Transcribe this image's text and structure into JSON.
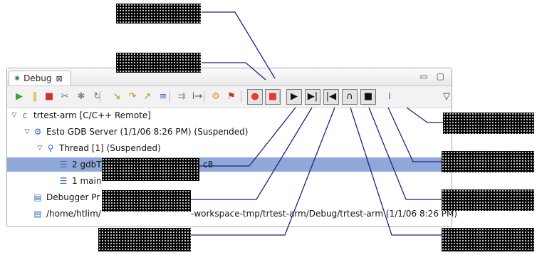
{
  "view": {
    "tab_title": "Debug",
    "tab_close": "⊠",
    "window_controls": "▭ ▢"
  },
  "toolbar_buttons": [
    {
      "name": "resume-icon",
      "glyph": "▶",
      "color": "#3aa03a"
    },
    {
      "name": "suspend-icon",
      "glyph": "‖",
      "color": "#c9a000"
    },
    {
      "name": "terminate-icon",
      "glyph": "■",
      "color": "#d32f2f"
    },
    {
      "name": "disconnect-icon",
      "glyph": "✂",
      "color": "#607d8b"
    },
    {
      "name": "remove-terminated-icon",
      "glyph": "✱",
      "color": "#7f8c8d"
    },
    {
      "name": "relaunch-icon",
      "glyph": "↻",
      "color": "#8e6b2e"
    },
    {
      "name": "step-into-icon",
      "glyph": "↘",
      "color": "#c08a00"
    },
    {
      "name": "step-over-icon",
      "glyph": "↷",
      "color": "#c08a00"
    },
    {
      "name": "step-return-icon",
      "glyph": "↗",
      "color": "#c08a00"
    },
    {
      "name": "drop-to-frame-icon",
      "glyph": "≡",
      "color": "#3b6fb6"
    },
    {
      "name": "instruction-stepping-icon",
      "glyph": "⇉",
      "color": "#888888"
    },
    {
      "name": "step-filters-icon",
      "glyph": "i→",
      "color": "#555555"
    },
    {
      "name": "connect-icon",
      "glyph": "⚙",
      "color": "#d4a017"
    },
    {
      "name": "disconnect-target-icon",
      "glyph": "⚑",
      "color": "#c0392b"
    },
    {
      "name": "record-icon",
      "glyph": "●",
      "color": "#e53935"
    },
    {
      "name": "stop-record-icon",
      "glyph": "■",
      "color": "#e53935"
    },
    {
      "name": "run-icon",
      "glyph": "▶",
      "color": "#111111"
    },
    {
      "name": "step-forward-icon",
      "glyph": "▶|",
      "color": "#111111"
    },
    {
      "name": "step-back-icon",
      "glyph": "|◀",
      "color": "#111111"
    },
    {
      "name": "reverse-icon",
      "glyph": "∩",
      "color": "#111111"
    },
    {
      "name": "stop-icon",
      "glyph": "■",
      "color": "#111111"
    },
    {
      "name": "info-icon",
      "glyph": "i",
      "color": "#1565c0"
    },
    {
      "name": "view-menu-icon",
      "glyph": "▽",
      "color": "#444444"
    }
  ],
  "tree": [
    {
      "twisty": "▽",
      "icon": "c",
      "label": "trtest-arm [C/C++ Remote]"
    },
    {
      "twisty": "▽",
      "icon": "⚙",
      "label": "Esto GDB Server (1/1/06 8:26 PM) (Suspended)"
    },
    {
      "twisty": "▽",
      "icon": "⚲",
      "label": "Thread [1] (Suspended)"
    },
    {
      "twisty": "",
      "icon": "☰",
      "label": "2 gdbT",
      "label_tail": "c8",
      "selected": true
    },
    {
      "twisty": "",
      "icon": "☰",
      "label": "1 main"
    },
    {
      "twisty": "",
      "icon": "▤",
      "label": "Debugger Pr"
    },
    {
      "twisty": "",
      "icon": "▤",
      "label": "/home/htlim/",
      "label_tail": "-workspace-tmp/trtest-arm/Debug/trtest-arm (1/1/06 8:26 PM)"
    }
  ]
}
